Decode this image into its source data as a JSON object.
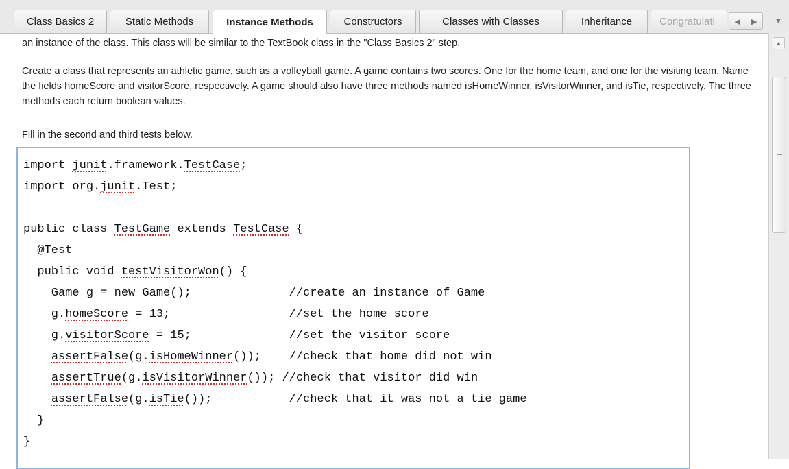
{
  "tabs": [
    {
      "label": "Class Basics 2"
    },
    {
      "label": "Static Methods"
    },
    {
      "label": "Instance Methods"
    },
    {
      "label": "Constructors"
    },
    {
      "label": "Classes with Classes"
    },
    {
      "label": "Inheritance"
    },
    {
      "label": "Congratulati"
    }
  ],
  "active_tab": "Instance Methods",
  "icons": {
    "tab_prev": "chevron-left-icon",
    "tab_next": "chevron-right-icon",
    "tab_menu": "chevron-down-icon",
    "scroll_up": "chevron-up-icon"
  },
  "instructions": {
    "p0": "an instance of the class. This class will be similar to the TextBook class in the \"Class Basics 2\" step.",
    "p1": "Create a class that represents an athletic game, such as a volleyball game. A game contains two scores. One for the home team, and one for the visiting team. Name the fields homeScore and visitorScore, respectively. A game should also have three methods named isHomeWinner, isVisitorWinner, and isTie, respectively. The three methods each return boolean values.",
    "p2": "Fill in the second and third tests below."
  },
  "code_lines": [
    "import junit.framework.TestCase;",
    "import org.junit.Test;",
    "",
    "public class TestGame extends TestCase {",
    "  @Test",
    "  public void testVisitorWon() {",
    "    Game g = new Game();              //create an instance of Game",
    "    g.homeScore = 13;                 //set the home score",
    "    g.visitorScore = 15;              //set the visitor score",
    "    assertFalse(g.isHomeWinner());    //check that home did not win",
    "    assertTrue(g.isVisitorWinner()); //check that visitor did win",
    "    assertFalse(g.isTie());           //check that it was not a tie game",
    "  }",
    "}"
  ],
  "spellcheck_words": [
    "junit",
    "TestCase",
    "TestGame",
    "testVisitorWon",
    "homeScore",
    "visitorScore",
    "assertFalse",
    "isHomeWinner",
    "assertTrue",
    "isVisitorWinner",
    "isTie"
  ],
  "colors": {
    "editor_border": "#8fb4e2",
    "spellcheck_underline": "#d42a2a"
  }
}
